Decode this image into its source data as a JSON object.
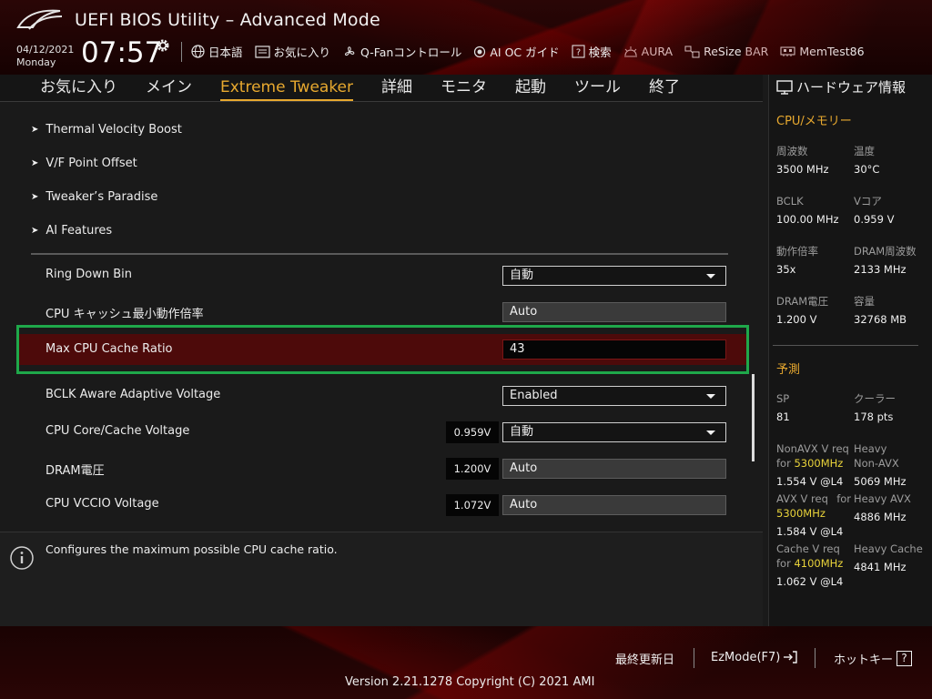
{
  "header": {
    "title": "UEFI BIOS Utility – Advanced Mode",
    "date": "04/12/2021",
    "day": "Monday",
    "time": "07:57",
    "toolbar": [
      {
        "icon": "globe-icon",
        "label": "日本語"
      },
      {
        "icon": "favorites-icon",
        "label": "お気に入り"
      },
      {
        "icon": "fan-icon",
        "label": "Q-Fanコントロール"
      },
      {
        "icon": "ai-oc-icon",
        "label": "AI OC ガイド"
      },
      {
        "icon": "help-search-icon",
        "label": "検索"
      },
      {
        "icon": "aura-icon",
        "label": "AURA"
      },
      {
        "icon": "resize-bar-icon",
        "label": "ReSize BAR"
      },
      {
        "icon": "memtest-icon",
        "label": "MemTest86"
      }
    ]
  },
  "nav": {
    "tabs": [
      {
        "label": "お気に入り",
        "active": false
      },
      {
        "label": "メイン",
        "active": false
      },
      {
        "label": "Extreme Tweaker",
        "active": true
      },
      {
        "label": "詳細",
        "active": false
      },
      {
        "label": "モニタ",
        "active": false
      },
      {
        "label": "起動",
        "active": false
      },
      {
        "label": "ツール",
        "active": false
      },
      {
        "label": "終了",
        "active": false
      }
    ]
  },
  "main": {
    "submenus": [
      "Thermal Velocity Boost",
      "V/F Point Offset",
      "Tweaker’s Paradise",
      "AI Features"
    ],
    "settings": [
      {
        "label": "Ring Down Bin",
        "value": "自動",
        "control": "dropdown"
      },
      {
        "label": "CPU キャッシュ最小動作倍率",
        "value": "Auto",
        "control": "field"
      },
      {
        "label": "Max CPU Cache Ratio",
        "value": "43",
        "control": "input",
        "selected": true
      },
      {
        "label": "BCLK Aware Adaptive Voltage",
        "value": "Enabled",
        "control": "dropdown"
      },
      {
        "label": "CPU Core/Cache Voltage",
        "voltage": "0.959V",
        "value": "自動",
        "control": "dropdown"
      },
      {
        "label": "DRAM電圧",
        "voltage": "1.200V",
        "value": "Auto",
        "control": "field"
      },
      {
        "label": "CPU VCCIO Voltage",
        "voltage": "1.072V",
        "value": "Auto",
        "control": "field"
      }
    ]
  },
  "help": {
    "text": "Configures the maximum possible CPU cache ratio."
  },
  "hw": {
    "title": "ハードウェア情報",
    "cpu_section": "CPU/メモリー",
    "cpu": [
      {
        "label": "周波数",
        "value": "3500 MHz"
      },
      {
        "label": "温度",
        "value": "30°C"
      },
      {
        "label": "BCLK",
        "value": "100.00 MHz"
      },
      {
        "label": "Vコア",
        "value": "0.959 V"
      },
      {
        "label": "動作倍率",
        "value": "35x"
      },
      {
        "label": "DRAM周波数",
        "value": "2133 MHz"
      },
      {
        "label": "DRAM電圧",
        "value": "1.200 V"
      },
      {
        "label": "容量",
        "value": "32768 MB"
      }
    ],
    "predict_section": "予測",
    "sp": {
      "label": "SP",
      "value": "81"
    },
    "cooler": {
      "label": "クーラー",
      "value": "178 pts"
    },
    "nonavx": {
      "l1": "NonAVX V req",
      "l2": "for",
      "freq": "5300MHz",
      "value": "1.554 V @L4"
    },
    "heavy_nonavx": {
      "l1": "Heavy",
      "l2": "Non-AVX",
      "value": "5069 MHz"
    },
    "avx": {
      "l1": "AVX V req",
      "l2": "for",
      "freq": "5300MHz",
      "value": "1.584 V @L4"
    },
    "heavy_avx": {
      "l1": "Heavy AVX",
      "value": "4886 MHz"
    },
    "cache": {
      "l1": "Cache V req",
      "l2": "for",
      "freq": "4100MHz",
      "value": "1.062 V @L4"
    },
    "heavy_cache": {
      "l1": "Heavy Cache",
      "value": "4841 MHz"
    }
  },
  "footer": {
    "last_modified": "最終更新日",
    "ezmode": "EzMode(F7)",
    "hotkeys": "ホットキー",
    "hotkey_symbol": "?",
    "version": "Version 2.21.1278 Copyright (C) 2021 AMI"
  },
  "colors": {
    "accent": "#e8a92f",
    "selected_row": "#4d0a0a",
    "highlight_frame": "#1fa84a",
    "predict_freq": "#e8d23a"
  }
}
